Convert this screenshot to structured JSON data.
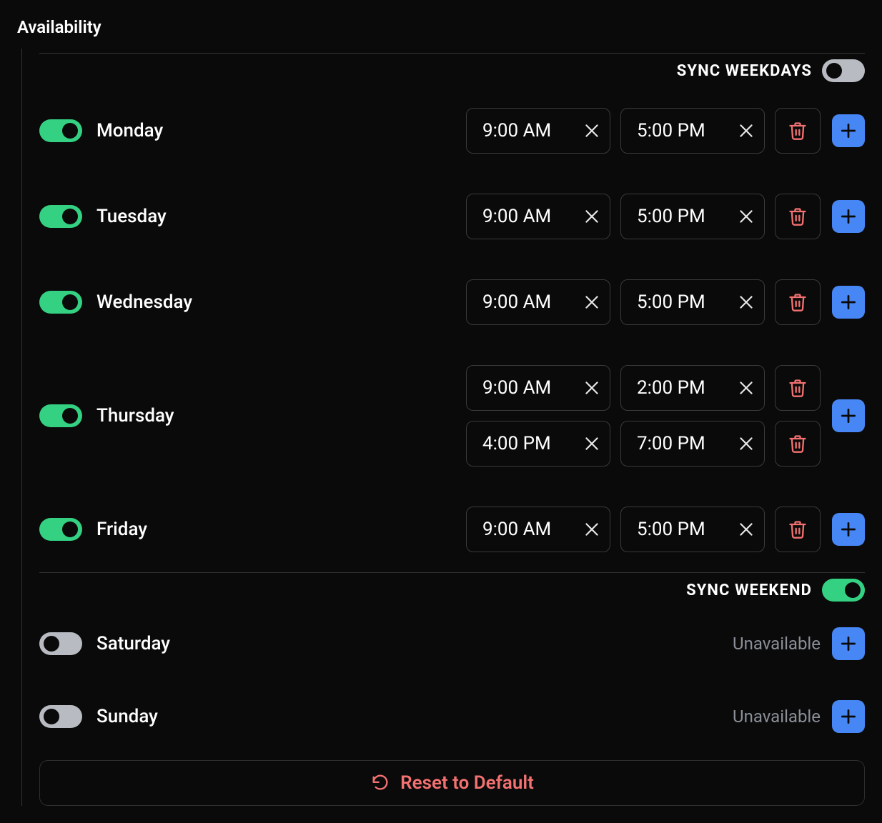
{
  "title": "Availability",
  "sync_weekdays_label": "SYNC WEEKDAYS",
  "sync_weekdays_on": false,
  "sync_weekend_label": "SYNC WEEKEND",
  "sync_weekend_on": true,
  "unavailable_label": "Unavailable",
  "reset_label": "Reset to Default",
  "days": [
    {
      "name": "Monday",
      "enabled": true,
      "slots": [
        {
          "start": "9:00 AM",
          "end": "5:00 PM"
        }
      ]
    },
    {
      "name": "Tuesday",
      "enabled": true,
      "slots": [
        {
          "start": "9:00 AM",
          "end": "5:00 PM"
        }
      ]
    },
    {
      "name": "Wednesday",
      "enabled": true,
      "slots": [
        {
          "start": "9:00 AM",
          "end": "5:00 PM"
        }
      ]
    },
    {
      "name": "Thursday",
      "enabled": true,
      "slots": [
        {
          "start": "9:00 AM",
          "end": "2:00 PM"
        },
        {
          "start": "4:00 PM",
          "end": "7:00 PM"
        }
      ]
    },
    {
      "name": "Friday",
      "enabled": true,
      "slots": [
        {
          "start": "9:00 AM",
          "end": "5:00 PM"
        }
      ]
    },
    {
      "name": "Saturday",
      "enabled": false,
      "slots": []
    },
    {
      "name": "Sunday",
      "enabled": false,
      "slots": []
    }
  ]
}
